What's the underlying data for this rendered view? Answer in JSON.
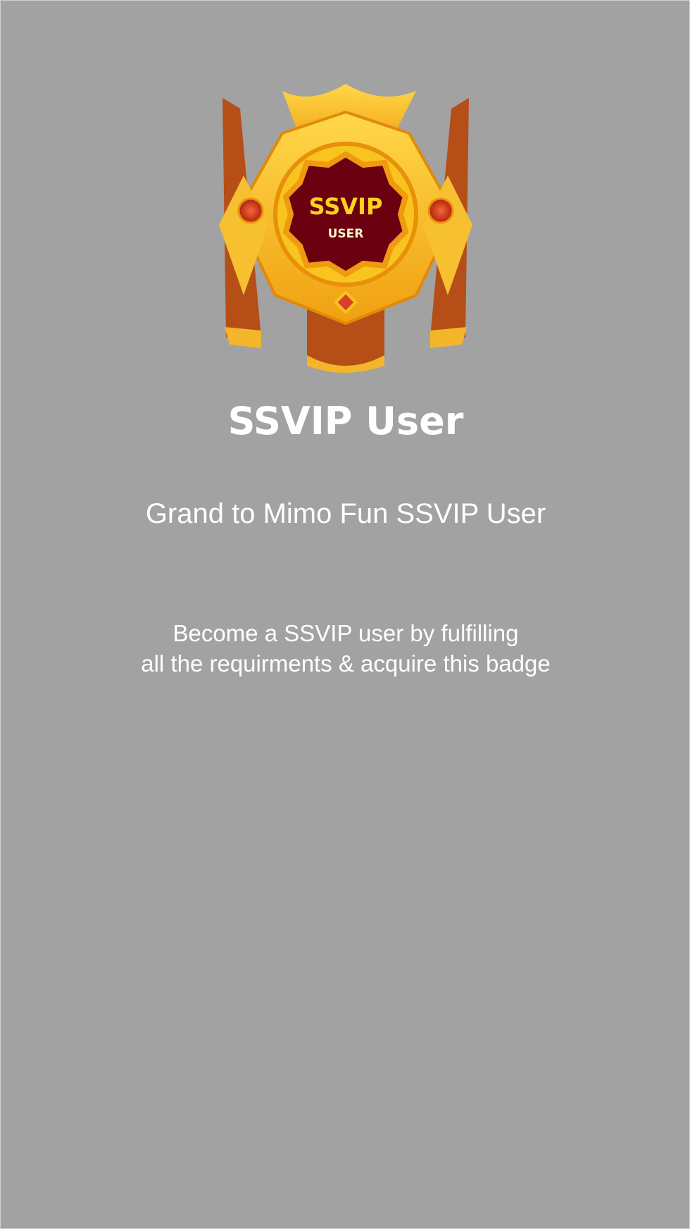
{
  "badge": {
    "line1": "SSVIP",
    "line2": "USER",
    "colors": {
      "gold": "#f7b51f",
      "maroon": "#6a0010",
      "ribbon": "#b64e17"
    }
  },
  "title": "SSVIP User",
  "subtitle": "Grand to Mimo Fun SSVIP User",
  "description": {
    "line1": "Become a SSVIP user by fulfilling",
    "line2": "all the requirments & acquire this badge"
  }
}
